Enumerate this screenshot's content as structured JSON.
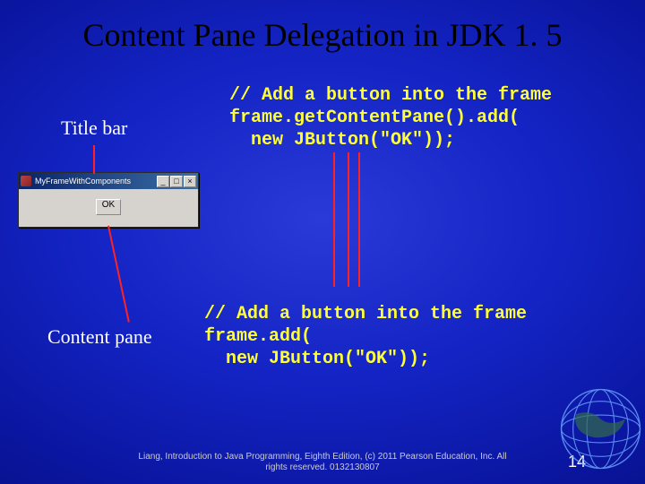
{
  "title": "Content Pane Delegation in JDK 1. 5",
  "labels": {
    "titlebar": "Title bar",
    "contentpane": "Content pane"
  },
  "code1": {
    "l1": "// Add a button into the frame",
    "l2": "frame.getContentPane().add(",
    "l3": "  new JButton(\"OK\"));"
  },
  "code2": {
    "l1": "// Add a button into the frame",
    "l2": "frame.add(",
    "l3": "  new JButton(\"OK\"));"
  },
  "jframe": {
    "title": "MyFrameWithComponents",
    "min": "_",
    "max": "□",
    "close": "×",
    "ok": "OK"
  },
  "footer": {
    "l1": "Liang, Introduction to Java Programming, Eighth Edition, (c) 2011 Pearson Education, Inc. All",
    "l2": "rights reserved. 0132130807"
  },
  "pagenum": "14"
}
